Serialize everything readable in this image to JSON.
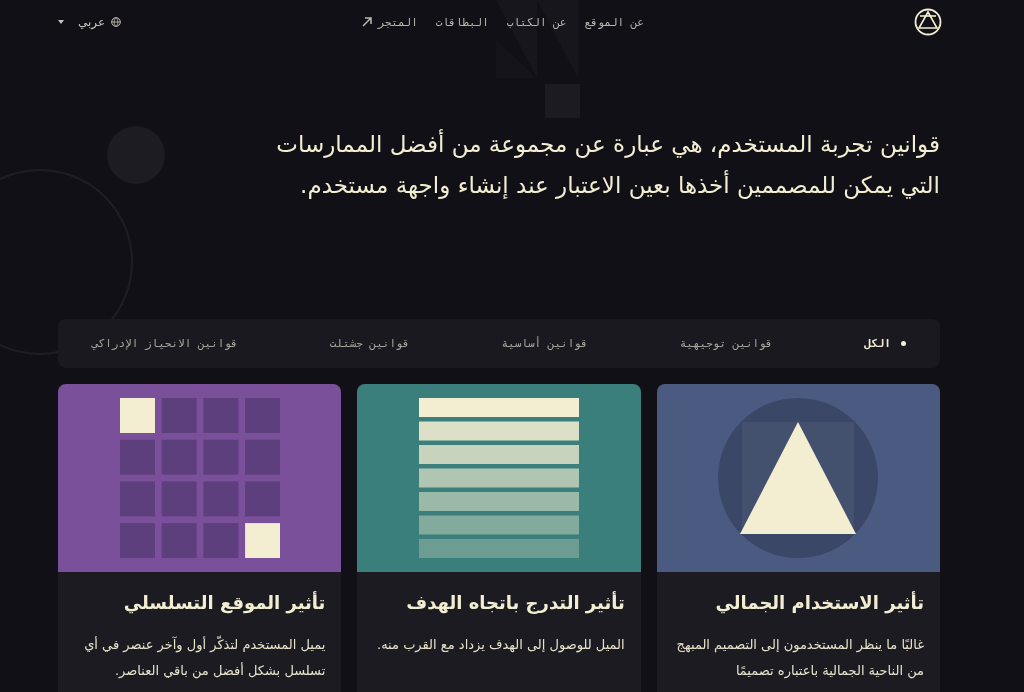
{
  "header": {
    "nav": [
      {
        "label": "عن الموقع"
      },
      {
        "label": "عن الكتاب"
      },
      {
        "label": "البطاقات"
      },
      {
        "label": "المتجر",
        "external": true
      }
    ],
    "language": "عربي"
  },
  "hero": {
    "text": "قوانين تجربة المستخدم، هي عبارة عن مجموعة من أفضل الممارسات التي يمكن للمصممين أخذها بعين الاعتبار عند إنشاء واجهة مستخدم."
  },
  "filters": [
    {
      "label": "الكل",
      "selected": true
    },
    {
      "label": "قوانين توجيهية",
      "selected": false
    },
    {
      "label": "قوانين أساسية",
      "selected": false
    },
    {
      "label": "قوانين جشتلت",
      "selected": false
    },
    {
      "label": "قوانين الانحياز الإدراكي",
      "selected": false
    }
  ],
  "cards": [
    {
      "kind": "triangle",
      "color": "#4b5a80",
      "title": "تأثير الاستخدام الجمالي",
      "text": "غالبًا ما ينظر المستخدمون إلى التصميم المبهج من الناحية الجمالية باعتباره تصميمًا"
    },
    {
      "kind": "bars",
      "color": "#3a7f7b",
      "title": "تأثير التدرج باتجاه الهدف",
      "text": "الميل للوصول إلى الهدف يزداد مع القرب منه."
    },
    {
      "kind": "grid",
      "color": "#7b509b",
      "title": "تأثير الموقع التسلسلي",
      "text": "يميل المستخدم لتذكّر أول وآخر عنصر في أي تسلسل بشكل أفضل من باقي العناصر."
    }
  ]
}
